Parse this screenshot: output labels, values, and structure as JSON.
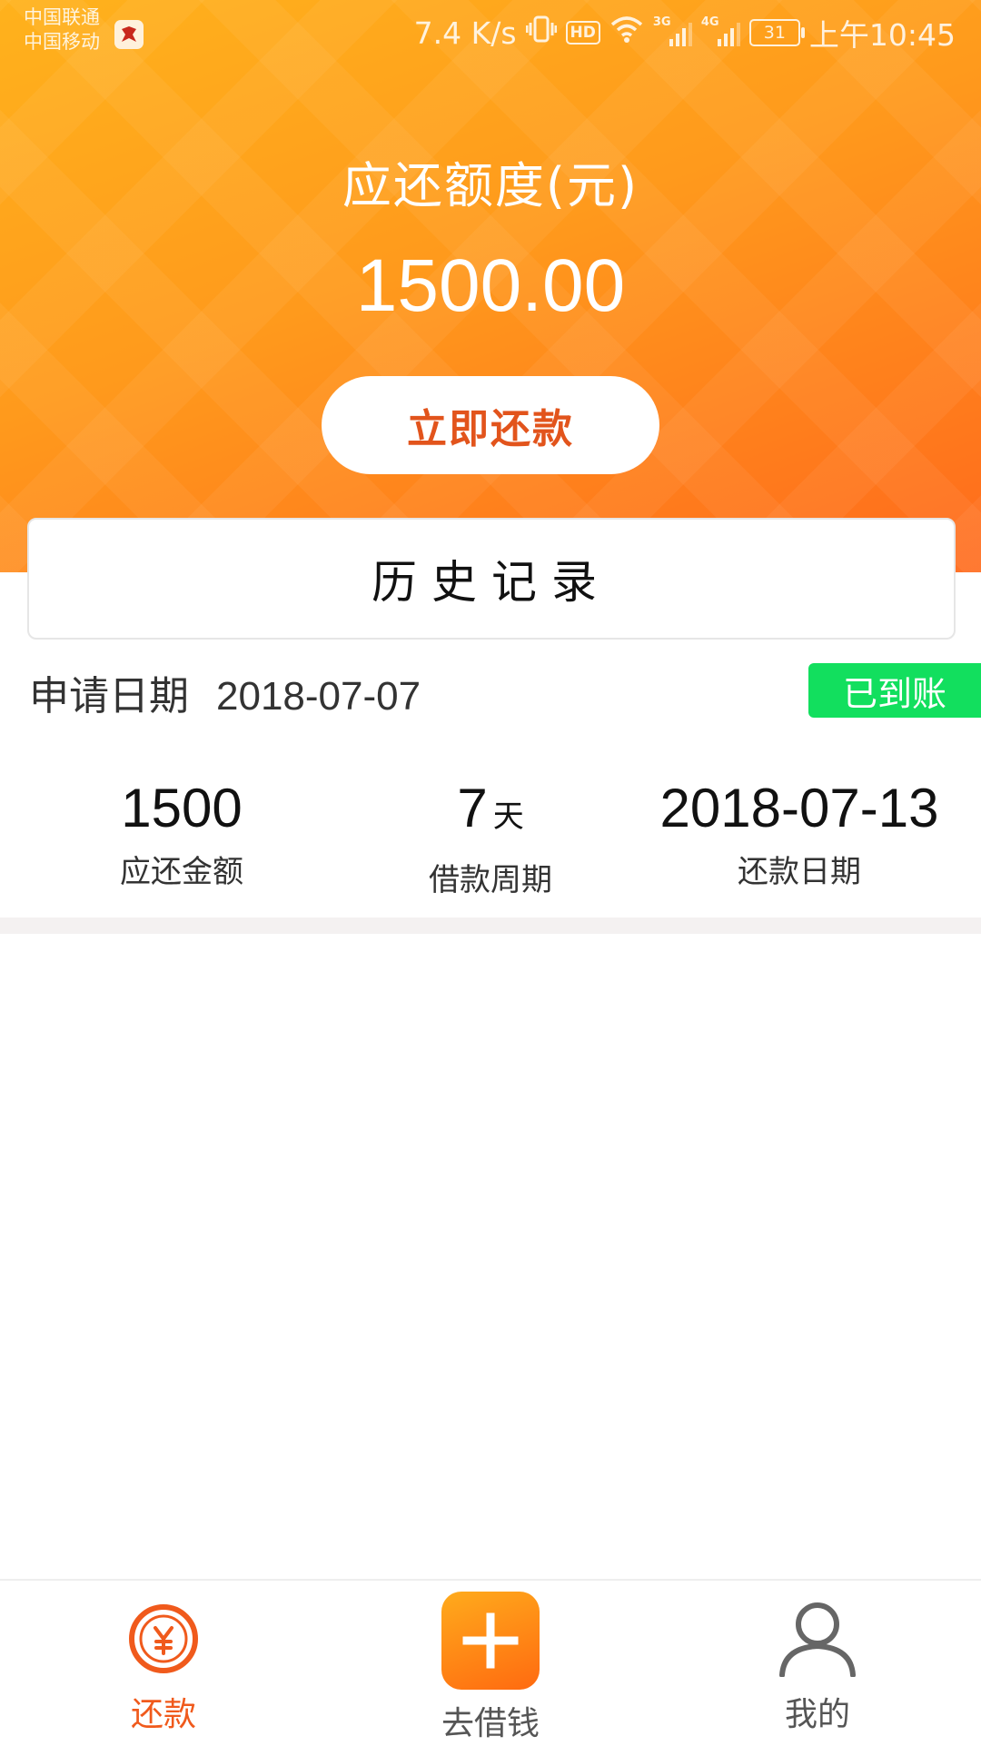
{
  "status_bar": {
    "carrier_1": "中国联通",
    "carrier_2": "中国移动",
    "speed": "7.4 K/s",
    "hd": "HD",
    "network_1": "3G",
    "network_2": "4G",
    "battery": "31",
    "time": "上午10:45"
  },
  "header": {
    "title": "应还额度(元)",
    "amount": "1500.00",
    "repay_button_label": "立即还款"
  },
  "history": {
    "label": "历史记录"
  },
  "record": {
    "apply_label": "申请日期",
    "apply_date": "2018-07-07",
    "status": "已到账",
    "stats": [
      {
        "value": "1500",
        "unit": "",
        "label": "应还金额"
      },
      {
        "value": "7",
        "unit": "天",
        "label": "借款周期"
      },
      {
        "value": "2018-07-13",
        "unit": "",
        "label": "还款日期"
      }
    ]
  },
  "bottom_nav": {
    "items": [
      {
        "label": "还款",
        "icon": "yuan-circle-icon",
        "active": true
      },
      {
        "label": "去借钱",
        "icon": "plus-icon",
        "active": false
      },
      {
        "label": "我的",
        "icon": "user-icon",
        "active": false
      }
    ]
  },
  "colors": {
    "brand_orange": "#ff8a1c",
    "accent_red_orange": "#e2541c",
    "status_green": "#12df5e",
    "nav_active": "#f05a1c"
  }
}
